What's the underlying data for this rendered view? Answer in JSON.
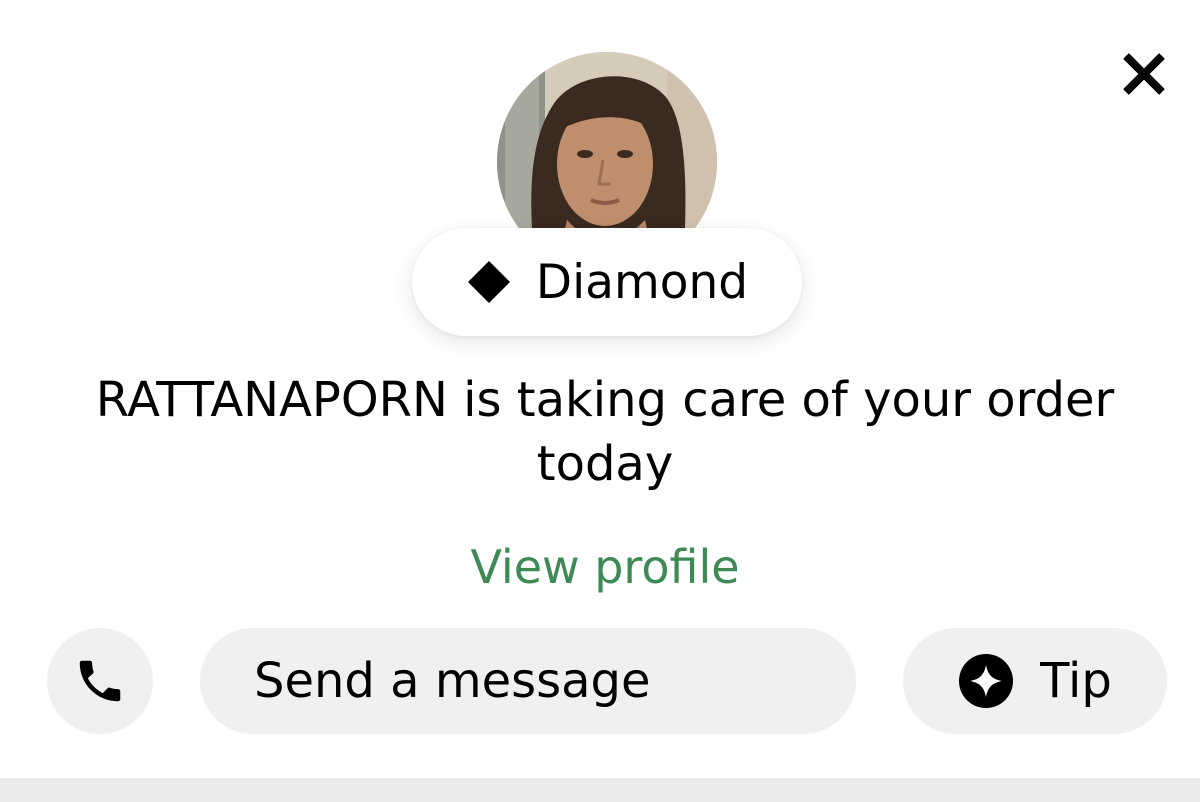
{
  "header": {
    "close_icon": "close-icon"
  },
  "courier": {
    "avatar_icon": "courier-avatar-photo",
    "badge": {
      "icon": "diamond-icon",
      "label": "Diamond"
    },
    "headline": "RATTANAPORN is taking care of your order today",
    "view_profile_label": "View profile"
  },
  "actions": {
    "phone_icon": "phone-icon",
    "message_label": "Send a message",
    "tip": {
      "icon": "sparkle-icon",
      "label": "Tip"
    }
  },
  "colors": {
    "accent_green": "#3d8a56",
    "button_bg": "#f0f0f0",
    "text": "#000000"
  }
}
